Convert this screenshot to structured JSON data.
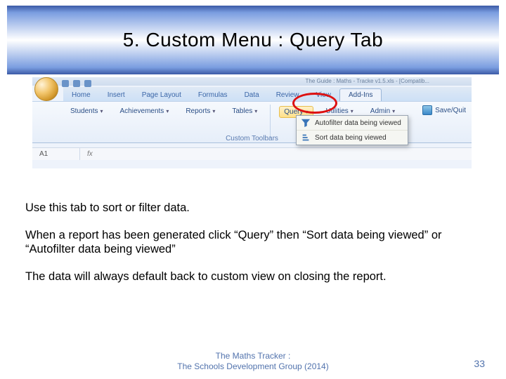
{
  "title": "5.  Custom Menu :  Query Tab",
  "screenshot": {
    "window_title_fragment": "The Guide : Maths - Tracke v1.5.xls - [Compatib...",
    "ribbon_tabs": [
      "Home",
      "Insert",
      "Page Layout",
      "Formulas",
      "Data",
      "Review",
      "View",
      "Add-Ins"
    ],
    "active_tab": "Add-Ins",
    "custom_groups": [
      "Students",
      "Achievements",
      "Reports",
      "Tables",
      "Query",
      "Utilities",
      "Admin"
    ],
    "hover_group": "Query",
    "save_quit": "Save/Quit",
    "dropdown_items": [
      "Autofilter data being viewed",
      "Sort data being viewed"
    ],
    "ribbon_section_label": "Custom Toolbars",
    "name_box": "A1",
    "fx_label": "fx"
  },
  "paragraphs": [
    "Use this tab to sort or filter data.",
    "When a report has been generated click “Query” then “Sort data being viewed” or “Autofilter data being viewed”",
    "The data will always default back to custom view on closing the report."
  ],
  "footer": {
    "line1": "The Maths Tracker :",
    "line2": "The Schools Development Group (2014)"
  },
  "page_number": "33"
}
